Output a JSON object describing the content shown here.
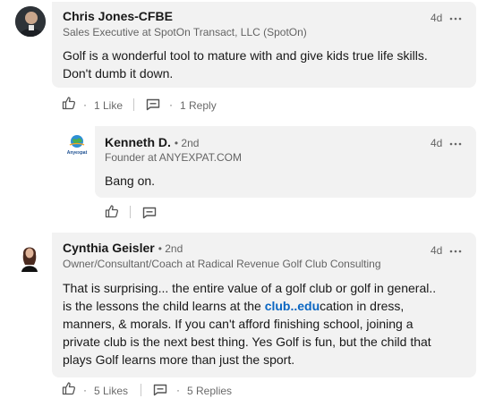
{
  "comments": [
    {
      "name": "Chris Jones-CFBE",
      "headline": "Sales Executive at SpotOn Transact, LLC (SpotOn)",
      "time": "4d",
      "body": "Golf is a wonderful tool to mature with and give kids true life skills. Don't dumb it down.",
      "likes": "1 Like",
      "replies": "1 Reply"
    },
    {
      "name": "Kenneth D.",
      "degree": "• 2nd",
      "headline": "Founder at ANYEXPAT.COM",
      "time": "4d",
      "body": "Bang on.",
      "logo_text": "Anyexpat"
    },
    {
      "name": "Cynthia Geisler",
      "degree": "• 2nd",
      "headline": "Owner/Consultant/Coach at Radical Revenue Golf Club Consulting",
      "time": "4d",
      "body_lines": [
        "That is surprising... the entire value of a golf club or golf in general..",
        "is the lessons the child learns at the ",
        "club..edu",
        "cation in dress,",
        "manners, & morals. If you can't afford finishing school, joining a",
        "private club is the next best thing.  Yes Golf is fun, but the child that",
        "plays Golf learns more than just the sport."
      ],
      "likes": "5 Likes",
      "replies": "5 Replies"
    }
  ],
  "ui": {
    "separator_dot": "·"
  },
  "colors": {
    "link": "#0a66c2",
    "bubble": "#f2f2f2",
    "meta": "#666666"
  },
  "icons": [
    "like-icon",
    "reply-icon",
    "more-icon"
  ]
}
